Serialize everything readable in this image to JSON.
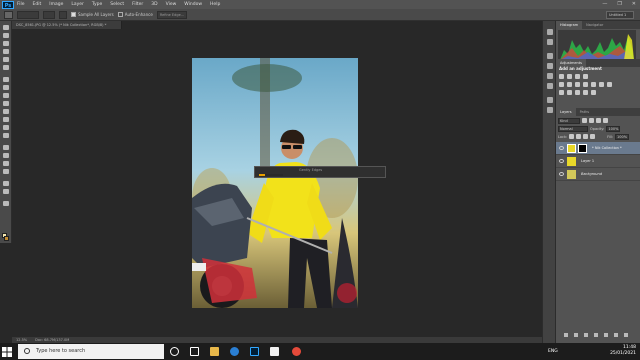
{
  "menubar": {
    "logo": "Ps",
    "items": [
      "File",
      "Edit",
      "Image",
      "Layer",
      "Type",
      "Select",
      "Filter",
      "3D",
      "View",
      "Window",
      "Help"
    ],
    "window_controls": [
      "—",
      "❐",
      "✕"
    ]
  },
  "options": {
    "sample_all_layers": "Sample All Layers",
    "auto_enhance": "Auto-Enhance",
    "refine_edge": "Refine Edge...",
    "workspace": "Untitled 1"
  },
  "document": {
    "tab_title": "DSC_8561.JPG @ 12.5% (* Nik Collection*, RGB/8) *",
    "zoom": "12.5%",
    "doc_size": "Doc: 68.7M/137.0M"
  },
  "progress": {
    "label": "Gently Edges",
    "fraction": 0.25
  },
  "panels": {
    "histogram_tab": "Histogram",
    "navigator_tab": "Navigator",
    "adjustments_tab": "Adjustments",
    "add_adjustment": "Add an adjustment",
    "layers_tab": "Layers",
    "paths_tab": "Paths",
    "kind_label": "Kind",
    "blend_mode": "Normal",
    "opacity_label": "Opacity:",
    "opacity_value": "100%",
    "lock_label": "Lock:",
    "fill_label": "Fill:",
    "fill_value": "100%",
    "layers": [
      {
        "name": "* Nik Collection *",
        "selected": true
      },
      {
        "name": "Layer 1",
        "selected": false
      },
      {
        "name": "Background",
        "selected": false
      }
    ]
  },
  "taskbar": {
    "search_placeholder": "Type here to search",
    "lang": "ENG",
    "time": "11:48",
    "date": "25/01/2021"
  },
  "colors": {
    "accent": "#e8a000",
    "selected_layer": "#6a7a8e"
  }
}
